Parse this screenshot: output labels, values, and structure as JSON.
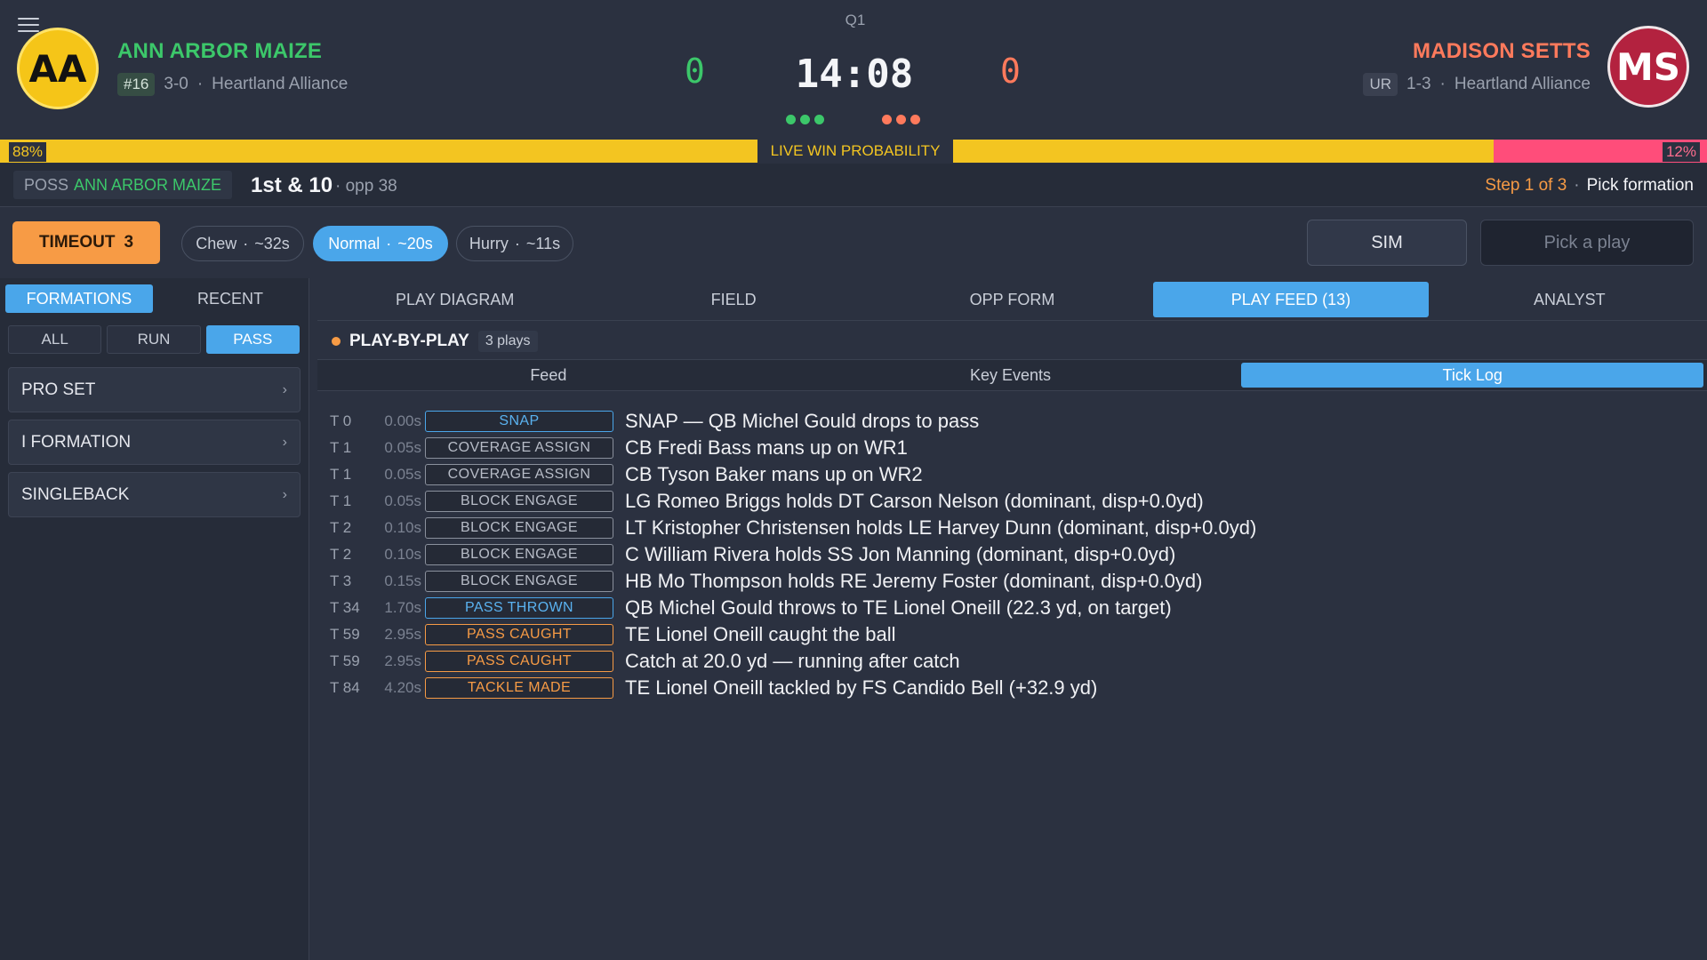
{
  "header": {
    "quarter": "Q1",
    "clock": "14:08",
    "home": {
      "initials": "AA",
      "name": "ANN ARBOR MAIZE",
      "rank": "#16",
      "record": "3-0",
      "conference": "Heartland Alliance",
      "score": "0",
      "timeouts_remaining": 3,
      "color": "#3cc76a",
      "logo_color": "#f5c518"
    },
    "away": {
      "initials": "MS",
      "name": "MADISON SETTS",
      "rank": "UR",
      "record": "1-3",
      "conference": "Heartland Alliance",
      "score": "0",
      "timeouts_remaining": 3,
      "color": "#ff7a5c",
      "logo_color": "#b3223f"
    },
    "separator": "·"
  },
  "win_probability": {
    "label": "LIVE WIN PROBABILITY",
    "home_pct": "88%",
    "away_pct": "12%",
    "home_value": 0.88,
    "away_value": 0.12
  },
  "possession": {
    "prefix": "POSS",
    "team": "ANN ARBOR MAIZE",
    "down_distance": "1st & 10",
    "field_position": "· opp 38",
    "step": "Step 1 of 3",
    "separator": "·",
    "action": "Pick formation"
  },
  "controls": {
    "timeout_label": "TIMEOUT",
    "timeout_count": "3",
    "tempo": [
      {
        "name": "Chew",
        "sep": "·",
        "time": "~32s",
        "active": false
      },
      {
        "name": "Normal",
        "sep": "·",
        "time": "~20s",
        "active": true
      },
      {
        "name": "Hurry",
        "sep": "·",
        "time": "~11s",
        "active": false
      }
    ],
    "sim_label": "SIM",
    "pick_placeholder": "Pick a play"
  },
  "sidebar": {
    "tabs": [
      "FORMATIONS",
      "RECENT"
    ],
    "active_tab": "FORMATIONS",
    "filters": [
      "ALL",
      "RUN",
      "PASS"
    ],
    "active_filter": "PASS",
    "formations": [
      "PRO SET",
      "I FORMATION",
      "SINGLEBACK"
    ],
    "chevron": "›"
  },
  "main": {
    "tabs": [
      "PLAY DIAGRAM",
      "FIELD",
      "OPP FORM",
      "PLAY FEED  (13)",
      "ANALYST"
    ],
    "active_tab": "PLAY FEED  (13)",
    "feed_title": "PLAY-BY-PLAY",
    "feed_count": "3 plays",
    "sub_tabs": [
      "Feed",
      "Key Events",
      "Tick Log"
    ],
    "active_sub_tab": "Tick Log",
    "log": [
      {
        "tick": "T 0",
        "time": "0.00s",
        "tag": "SNAP",
        "tone": "blue",
        "desc": "SNAP — QB Michel Gould drops to pass"
      },
      {
        "tick": "T 1",
        "time": "0.05s",
        "tag": "COVERAGE ASSIGN",
        "tone": "grey",
        "desc": "CB Fredi Bass mans up on WR1"
      },
      {
        "tick": "T 1",
        "time": "0.05s",
        "tag": "COVERAGE ASSIGN",
        "tone": "grey",
        "desc": "CB Tyson Baker mans up on WR2"
      },
      {
        "tick": "T 1",
        "time": "0.05s",
        "tag": "BLOCK ENGAGE",
        "tone": "grey",
        "desc": "LG Romeo Briggs holds DT Carson Nelson (dominant, disp+0.0yd)"
      },
      {
        "tick": "T 2",
        "time": "0.10s",
        "tag": "BLOCK ENGAGE",
        "tone": "grey",
        "desc": "LT Kristopher Christensen holds LE Harvey Dunn (dominant, disp+0.0yd)"
      },
      {
        "tick": "T 2",
        "time": "0.10s",
        "tag": "BLOCK ENGAGE",
        "tone": "grey",
        "desc": "C William Rivera holds SS Jon Manning (dominant, disp+0.0yd)"
      },
      {
        "tick": "T 3",
        "time": "0.15s",
        "tag": "BLOCK ENGAGE",
        "tone": "grey",
        "desc": "HB Mo Thompson holds RE Jeremy Foster (dominant, disp+0.0yd)"
      },
      {
        "tick": "T 34",
        "time": "1.70s",
        "tag": "PASS THROWN",
        "tone": "blue",
        "desc": "QB Michel Gould throws to TE Lionel Oneill (22.3 yd, on target)"
      },
      {
        "tick": "T 59",
        "time": "2.95s",
        "tag": "PASS CAUGHT",
        "tone": "orange",
        "desc": "TE Lionel Oneill caught the ball"
      },
      {
        "tick": "T 59",
        "time": "2.95s",
        "tag": "PASS CAUGHT",
        "tone": "orange",
        "desc": "Catch at 20.0 yd — running after catch"
      },
      {
        "tick": "T 84",
        "time": "4.20s",
        "tag": "TACKLE MADE",
        "tone": "orange",
        "desc": "TE Lionel Oneill tackled by FS Candido Bell (+32.9 yd)"
      }
    ]
  },
  "colors": {
    "accent": "#4aa6ea",
    "home": "#3cc76a",
    "away": "#ff7a5c",
    "timeout": "#f79b45",
    "win_home": "#f3c521",
    "win_away": "#ff4d7a"
  },
  "icons": {
    "menu": "menu-icon",
    "chevron": "chevron-right-icon"
  }
}
